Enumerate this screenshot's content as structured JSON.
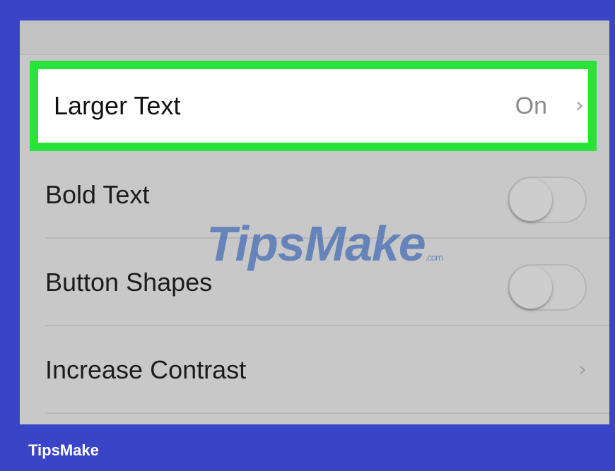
{
  "settings": {
    "rows": [
      {
        "label": "Larger Text",
        "value": "On",
        "control": "chevron",
        "highlighted": true
      },
      {
        "label": "Bold Text",
        "control": "toggle",
        "checked": false
      },
      {
        "label": "Button Shapes",
        "control": "toggle",
        "checked": false
      },
      {
        "label": "Increase Contrast",
        "control": "chevron"
      }
    ],
    "chevron_glyph": "›"
  },
  "colors": {
    "frame": "#3a44c6",
    "highlight_border": "#27e33a"
  },
  "watermark": {
    "main": "TipsMake",
    "tail": ".com"
  },
  "footer": {
    "brand": "TipsMake"
  }
}
